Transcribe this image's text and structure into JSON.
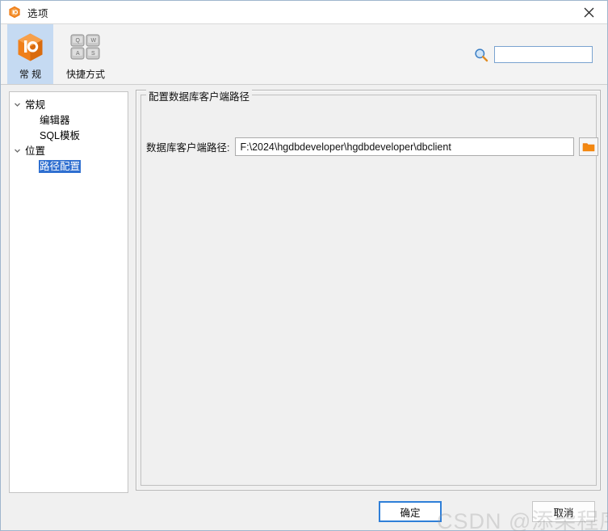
{
  "window": {
    "title": "选项",
    "icon": "app-hexagon-icon",
    "close_label": "×"
  },
  "toolbar": {
    "tabs": [
      {
        "label": "常  规",
        "icon": "general-hexagon-icon",
        "selected": true
      },
      {
        "label": "快捷方式",
        "icon": "keyboard-keys-icon",
        "selected": false
      }
    ],
    "key_glyphs": [
      "Q",
      "W",
      "A",
      "S"
    ],
    "search": {
      "icon": "search-icon",
      "value": "",
      "placeholder": ""
    }
  },
  "tree": {
    "nodes": [
      {
        "label": "常规",
        "level": 0,
        "expanded": true,
        "selected": false
      },
      {
        "label": "编辑器",
        "level": 1,
        "expanded": false,
        "selected": false
      },
      {
        "label": "SQL模板",
        "level": 1,
        "expanded": false,
        "selected": false
      },
      {
        "label": "位置",
        "level": 0,
        "expanded": true,
        "selected": false
      },
      {
        "label": "路径配置",
        "level": 1,
        "expanded": false,
        "selected": true
      }
    ]
  },
  "content": {
    "group_title": "配置数据库客户端路径",
    "field_label": "数据库客户端路径:",
    "path_value": "F:\\2024\\hgdbdeveloper\\hgdbdeveloper\\dbclient",
    "path_placeholder": "",
    "browse_icon": "folder-icon"
  },
  "footer": {
    "ok_label": "确定",
    "cancel_label": "取消"
  },
  "watermark": {
    "text": "CSDN @添柴程序猿"
  },
  "colors": {
    "accent_orange": "#ed7d17",
    "selection_blue": "#2f6fd0",
    "tab_selected": "#c5daf2",
    "focus_border": "#2f7fd8",
    "window_bg": "#f0f0f0"
  }
}
